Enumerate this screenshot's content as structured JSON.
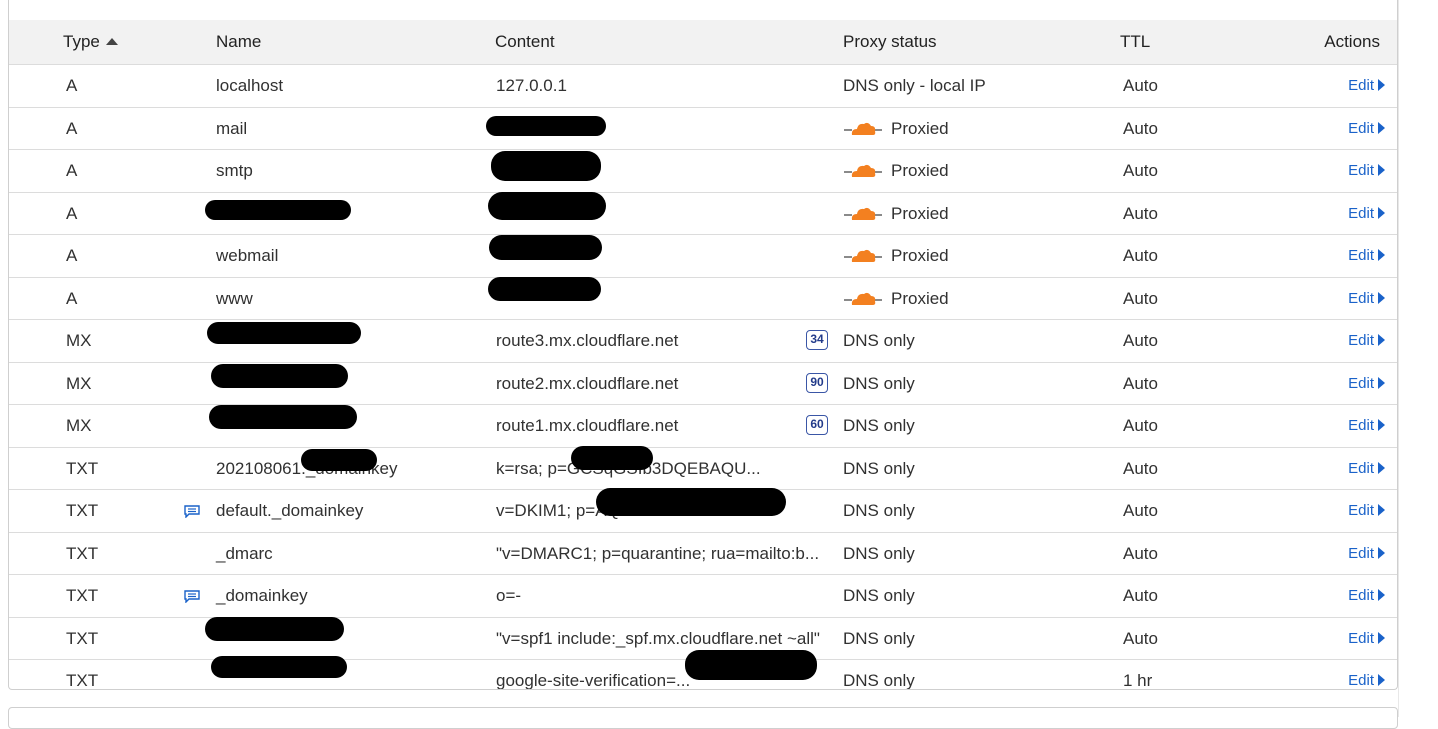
{
  "table": {
    "headers": {
      "type": "Type",
      "name": "Name",
      "content": "Content",
      "proxy": "Proxy status",
      "ttl": "TTL",
      "actions": "Actions"
    },
    "sort_icon": "sort-ascending-icon",
    "edit_label": "Edit",
    "proxied_icon": "orange-cloud-icon",
    "comment_icon": "comment-icon",
    "colors": {
      "cloud": "#f38020",
      "link": "#1a62c9",
      "priority_border": "#3a56a6"
    },
    "rows": [
      {
        "type": "A",
        "name": "localhost",
        "content": "127.0.0.1",
        "proxy": "DNS only - local IP",
        "ttl": "Auto"
      },
      {
        "type": "A",
        "name": "mail",
        "content": "",
        "proxy": "Proxied",
        "ttl": "Auto"
      },
      {
        "type": "A",
        "name": "smtp",
        "content": "",
        "proxy": "Proxied",
        "ttl": "Auto"
      },
      {
        "type": "A",
        "name": "",
        "content": "",
        "proxy": "Proxied",
        "ttl": "Auto"
      },
      {
        "type": "A",
        "name": "webmail",
        "content": "",
        "proxy": "Proxied",
        "ttl": "Auto"
      },
      {
        "type": "A",
        "name": "www",
        "content": "",
        "proxy": "Proxied",
        "ttl": "Auto"
      },
      {
        "type": "MX",
        "name": "",
        "content": "route3.mx.cloudflare.net",
        "priority": "34",
        "proxy": "DNS only",
        "ttl": "Auto"
      },
      {
        "type": "MX",
        "name": "",
        "content": "route2.mx.cloudflare.net",
        "priority": "90",
        "proxy": "DNS only",
        "ttl": "Auto"
      },
      {
        "type": "MX",
        "name": "",
        "content": "route1.mx.cloudflare.net",
        "priority": "60",
        "proxy": "DNS only",
        "ttl": "Auto"
      },
      {
        "type": "TXT",
        "name": "202108061._domainkey",
        "content": "k=rsa; p=GCSqGSIb3DQEBAQU...",
        "proxy": "DNS only",
        "ttl": "Auto"
      },
      {
        "type": "TXT",
        "name": "default._domainkey",
        "content": "v=DKIM1; p=AQE...",
        "proxy": "DNS only",
        "ttl": "Auto",
        "has_comment": true
      },
      {
        "type": "TXT",
        "name": "_dmarc",
        "content": "\"v=DMARC1; p=quarantine; rua=mailto:b...",
        "proxy": "DNS only",
        "ttl": "Auto"
      },
      {
        "type": "TXT",
        "name": "_domainkey",
        "content": "o=-",
        "proxy": "DNS only",
        "ttl": "Auto",
        "has_comment": true
      },
      {
        "type": "TXT",
        "name": "",
        "content": "\"v=spf1 include:_spf.mx.cloudflare.net ~all\"",
        "proxy": "DNS only",
        "ttl": "Auto"
      },
      {
        "type": "TXT",
        "name": "",
        "content": "google-site-verification=...",
        "proxy": "DNS only",
        "ttl": "1 hr"
      }
    ]
  }
}
